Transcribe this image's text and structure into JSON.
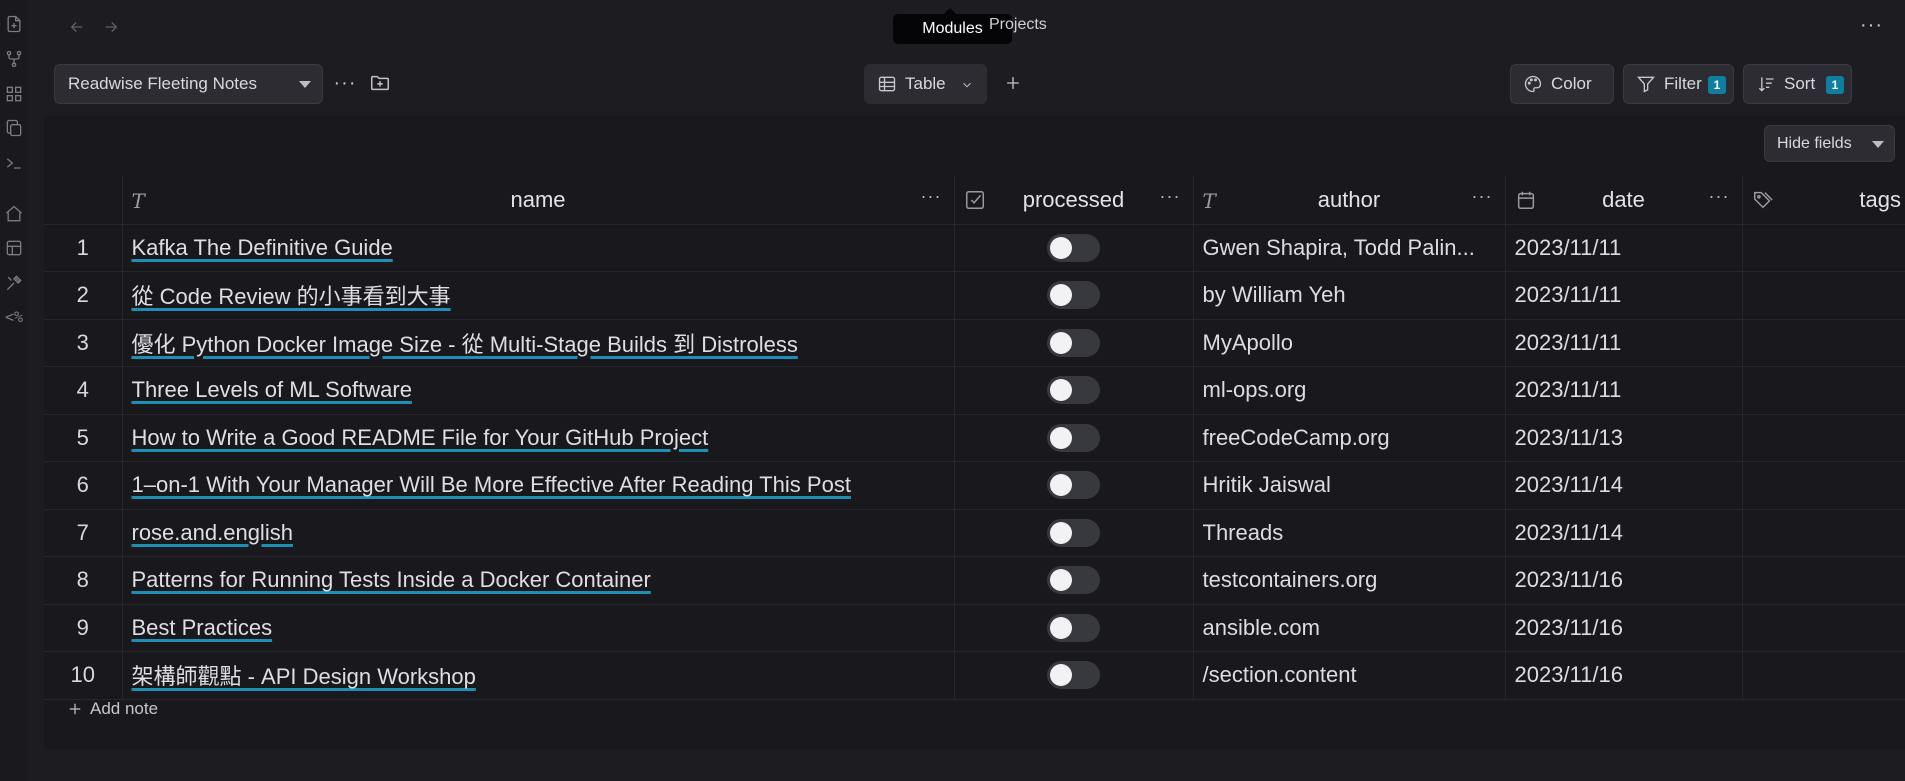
{
  "topbar": {
    "tooltip": "Modules",
    "tab_projects": "Projects",
    "more": "···"
  },
  "toolbar": {
    "database": "Readwise Fleeting Notes",
    "more": "···",
    "view": "Table",
    "color_label": "Color",
    "filter_label": "Filter",
    "filter_count": "1",
    "sort_label": "Sort",
    "sort_count": "1",
    "hide_fields": "Hide fields"
  },
  "columns": {
    "name": "name",
    "processed": "processed",
    "author": "author",
    "date": "date",
    "tags": "tags"
  },
  "rows": [
    {
      "num": "1",
      "name": "Kafka The Definitive Guide",
      "processed": false,
      "author": "Gwen Shapira, Todd Palin...",
      "date": "2023/11/11",
      "tags": ""
    },
    {
      "num": "2",
      "name": "從 Code Review 的小事看到大事",
      "processed": false,
      "author": "by William Yeh",
      "date": "2023/11/11",
      "tags": ""
    },
    {
      "num": "3",
      "name": "優化 Python Docker Image Size - 從 Multi-Stage Builds 到 Distroless",
      "processed": false,
      "author": "MyApollo",
      "date": "2023/11/11",
      "tags": ""
    },
    {
      "num": "4",
      "name": "Three Levels of ML Software",
      "processed": false,
      "author": "ml-ops.org",
      "date": "2023/11/11",
      "tags": ""
    },
    {
      "num": "5",
      "name": "How to Write a Good README File for Your GitHub Project",
      "processed": false,
      "author": "freeCodeCamp.org",
      "date": "2023/11/13",
      "tags": ""
    },
    {
      "num": "6",
      "name": "1–on-1 With Your Manager Will Be More Effective After Reading This Post",
      "processed": false,
      "author": "Hritik Jaiswal",
      "date": "2023/11/14",
      "tags": ""
    },
    {
      "num": "7",
      "name": "rose.and.english",
      "processed": false,
      "author": "Threads",
      "date": "2023/11/14",
      "tags": ""
    },
    {
      "num": "8",
      "name": "Patterns for Running Tests Inside a Docker Container",
      "processed": false,
      "author": "testcontainers.org",
      "date": "2023/11/16",
      "tags": ""
    },
    {
      "num": "9",
      "name": "Best Practices",
      "processed": false,
      "author": "ansible.com",
      "date": "2023/11/16",
      "tags": ""
    },
    {
      "num": "10",
      "name": "架構師觀點 - API Design Workshop",
      "processed": false,
      "author": "/section.content",
      "date": "2023/11/16",
      "tags": ""
    }
  ],
  "add_note": "Add note",
  "colors": {
    "background": "#1c1c21",
    "accent": "#0e7fa0",
    "link_underline": "#1e8fb3"
  },
  "ribbon": {
    "icons": [
      "file-plus-icon",
      "git-branch-icon",
      "grid-icon",
      "copy-icon",
      "terminal-icon",
      "home-icon",
      "layout-icon",
      "tools-icon",
      "template-icon"
    ],
    "template_text": "<%"
  }
}
